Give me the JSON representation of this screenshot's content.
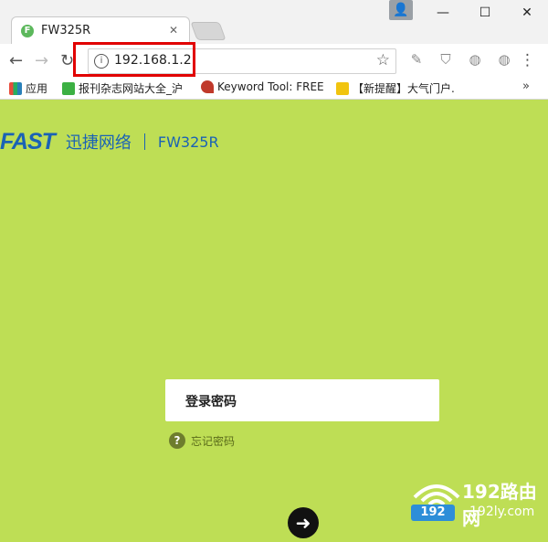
{
  "browser": {
    "tab_title": "FW325R",
    "tab_favicon_letter": "F",
    "url": "192.168.1.2",
    "bookmarks": [
      {
        "label": "应用"
      },
      {
        "label": "报刊杂志网站大全_沪"
      },
      {
        "label": "Keyword Tool: FREE"
      },
      {
        "label": "【新提醒】大气门户."
      }
    ],
    "more": "»"
  },
  "header": {
    "logo": "FAST",
    "brand": "迅捷网络",
    "model": "FW325R"
  },
  "login": {
    "password_placeholder": "登录密码",
    "forgot": "忘记密码"
  },
  "watermark": {
    "title": "192路由网",
    "domain": "192ly.com",
    "badge": "192"
  },
  "colors": {
    "page_bg": "#bede55",
    "brand_blue": "#1a62b5",
    "highlight_red": "#e10000"
  }
}
